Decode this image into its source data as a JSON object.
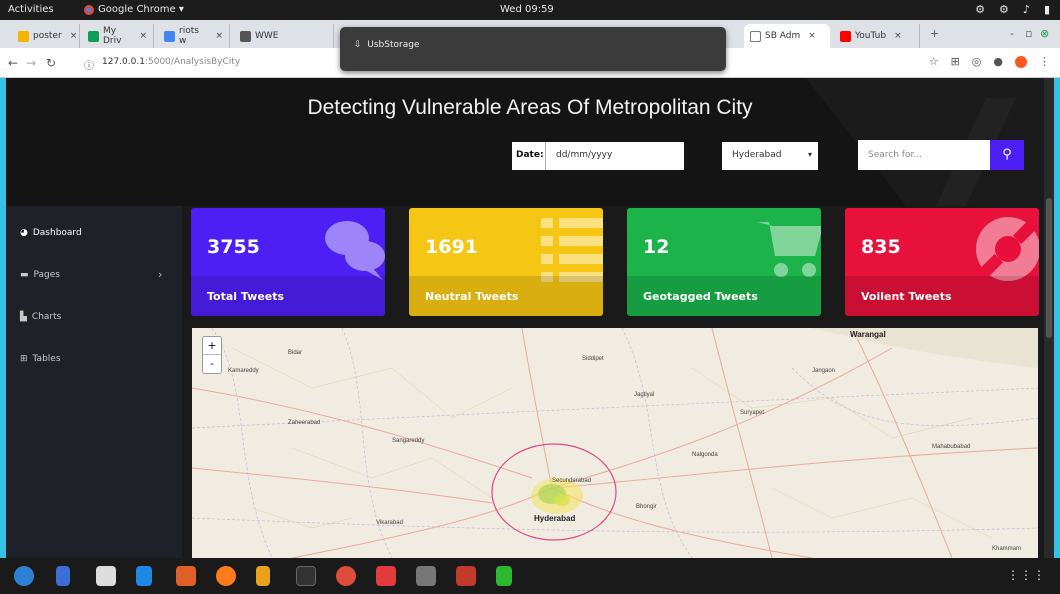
{
  "topbar": {
    "activities": "Activities",
    "app_name": "Google Chrome ▾",
    "clock": "Wed 09:59"
  },
  "tabs": [
    {
      "label": "poster",
      "fav_color": "#f4b400"
    },
    {
      "label": "My Driv",
      "fav_color": "#0f9d58"
    },
    {
      "label": "riots w",
      "fav_color": "#4285f4"
    },
    {
      "label": "WWE",
      "fav_color": "#555555"
    },
    {
      "label": "SB Adm",
      "fav_color": "#ffffff"
    },
    {
      "label": "YouTub",
      "fav_color": "#ff0000"
    }
  ],
  "popup": {
    "text": "UsbStorage"
  },
  "address": {
    "host": "127.0.0.1",
    "path": ":5000/AnalysisByCity"
  },
  "page": {
    "title": "Detecting Vulnerable Areas Of Metropolitan City",
    "date_label": "Date:",
    "date_placeholder": "dd/mm/yyyy",
    "city_selected": "Hyderabad",
    "search_placeholder": "Search for..."
  },
  "sidebar": {
    "items": [
      {
        "label": "Dashboard",
        "icon": "dashboard-icon"
      },
      {
        "label": "Pages",
        "icon": "folder-icon"
      },
      {
        "label": "Charts",
        "icon": "chart-icon"
      },
      {
        "label": "Tables",
        "icon": "table-icon"
      }
    ]
  },
  "cards": [
    {
      "value": "3755",
      "label": "Total Tweets",
      "color": "#4e1ff5",
      "icon": "comments-icon"
    },
    {
      "value": "1691",
      "label": "Neutral Tweets",
      "color": "#f6c614",
      "icon": "list-icon"
    },
    {
      "value": "12",
      "label": "Geotagged Tweets",
      "color": "#1bb34a",
      "icon": "cart-icon"
    },
    {
      "value": "835",
      "label": "Voilent Tweets",
      "color": "#e8113b",
      "icon": "life-ring-icon"
    }
  ],
  "map": {
    "zoom_in": "+",
    "zoom_out": "-",
    "places": [
      {
        "name": "Warangal",
        "big": true
      },
      {
        "name": "Hyderabad",
        "big": true
      },
      {
        "name": "Secunderabad",
        "big": false
      },
      {
        "name": "Bidar",
        "big": false
      },
      {
        "name": "Zaheerabad",
        "big": false
      },
      {
        "name": "Sangareddy",
        "big": false
      },
      {
        "name": "Jagtiyal",
        "big": false
      },
      {
        "name": "Nalgonda",
        "big": false
      },
      {
        "name": "Vikarabad",
        "big": false
      },
      {
        "name": "Bhongir",
        "big": false
      },
      {
        "name": "Suryapet",
        "big": false
      },
      {
        "name": "Mahabubabad",
        "big": false
      },
      {
        "name": "Khammam",
        "big": false
      },
      {
        "name": "Siddipet",
        "big": false
      },
      {
        "name": "Kamareddy",
        "big": false
      },
      {
        "name": "Jangaon",
        "big": false
      }
    ]
  }
}
